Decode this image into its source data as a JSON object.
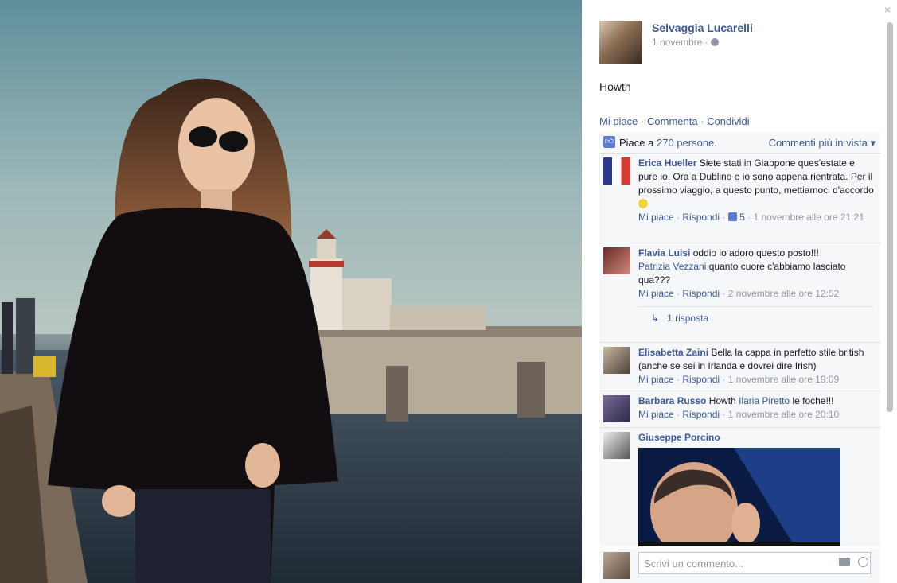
{
  "post": {
    "author": "Selvaggia Lucarelli",
    "date": "1 novembre",
    "date_sep": "·",
    "caption": "Howth",
    "actions": {
      "like": "Mi piace",
      "comment": "Commenta",
      "share": "Condividi",
      "sep": "·"
    }
  },
  "likes": {
    "prefix": "Piace a",
    "count_link": "270 persone",
    "suffix": ".",
    "sort_label": "Commenti più in vista",
    "sort_arrow": "▾"
  },
  "comments": [
    {
      "author": "Erica Hueller",
      "text": "Siete stati in Giappone ques'estate e pure io. Ora a Dublino e io sono appena rientrata. Per il prossimo viaggio, a questo punto, mettiamoci d'accordo",
      "like": "Mi piace",
      "reply": "Rispondi",
      "likes": "5",
      "time": "1 novembre alle ore 21:21"
    },
    {
      "author": "Flavia Luisi",
      "text": "oddio io adoro questo posto!!!",
      "mention": "Patrizia Vezzani",
      "text2": "quanto cuore c'abbiamo lasciato qua???",
      "like": "Mi piace",
      "reply": "Rispondi",
      "time": "2 novembre alle ore 12:52",
      "replies": "1 risposta"
    },
    {
      "author": "Elisabetta Zaini",
      "text": "Bella la cappa in perfetto stile british (anche se sei in Irlanda e dovrei dire Irish)",
      "like": "Mi piace",
      "reply": "Rispondi",
      "time": "1 novembre alle ore 19:09"
    },
    {
      "author": "Barbara Russo",
      "text": "Howth",
      "mention": "Ilaria Piretto",
      "text2": "le foche!!!",
      "like": "Mi piace",
      "reply": "Rispondi",
      "time": "1 novembre alle ore 20:10"
    },
    {
      "author": "Giuseppe Porcino"
    }
  ],
  "meta_sep": "·",
  "composer": {
    "placeholder": "Scrivi un commento..."
  },
  "close_glyph": "×",
  "icons": {
    "close": "close-icon",
    "globe": "globe-icon",
    "like": "thumbs-up-icon",
    "reply": "reply-arrow-icon",
    "camera": "camera-icon",
    "emoji": "emoji-icon"
  },
  "colors": {
    "link": "#3b5998",
    "meta": "#9197a3",
    "panel_bg": "#f6f7f9"
  }
}
